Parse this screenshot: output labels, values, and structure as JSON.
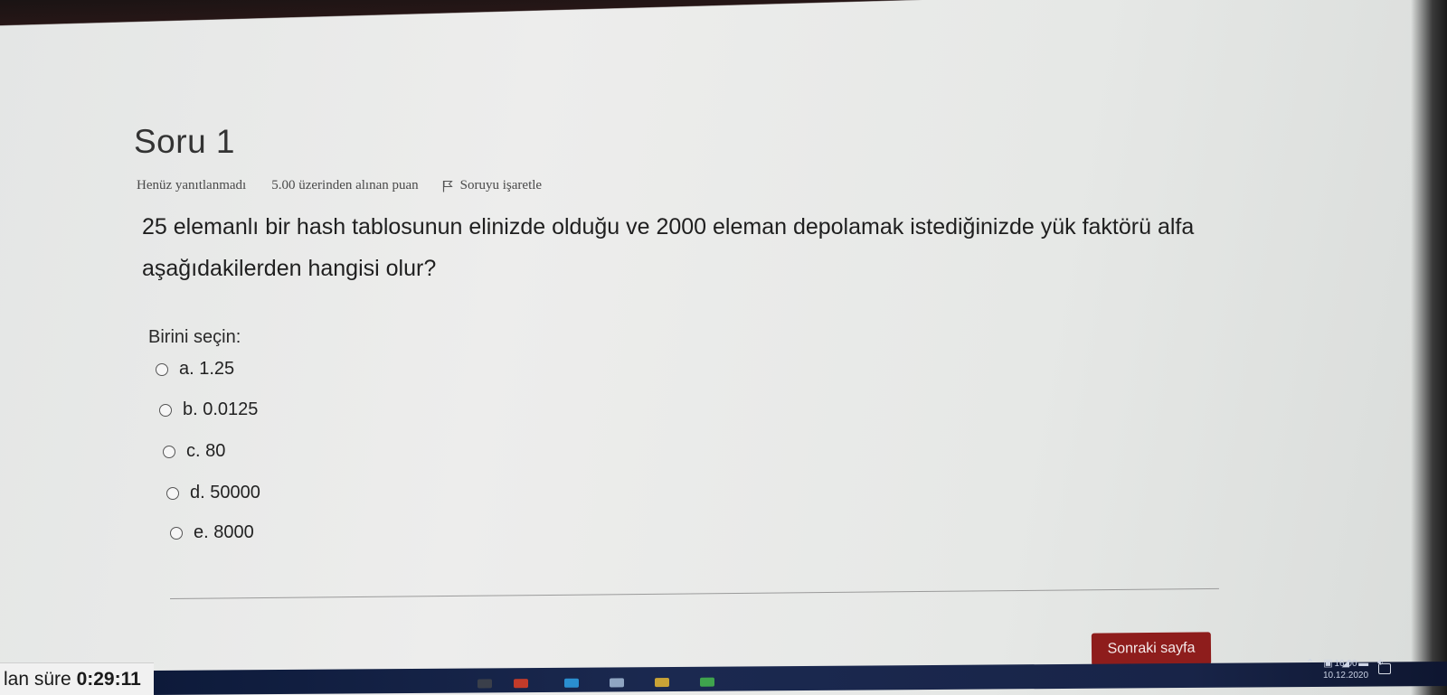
{
  "question": {
    "title": "Soru 1",
    "state": "Henüz yanıtlanmadı",
    "grade": "5.00 üzerinden alınan puan",
    "flag_label": "Soruyu işaretle",
    "text": "25 elemanlı bir hash tablosunun elinizde olduğu ve 2000 eleman depolamak istediğinizde yük faktörü alfa aşağıdakilerden hangisi olur?",
    "prompt": "Birini seçin:",
    "answers": [
      {
        "label": "a. 1.25",
        "selected": false
      },
      {
        "label": "b. 0.0125",
        "selected": false
      },
      {
        "label": "c. 80",
        "selected": false
      },
      {
        "label": "d. 50000",
        "selected": false
      },
      {
        "label": "e. 8000",
        "selected": false
      }
    ]
  },
  "navigation": {
    "next_label": "Sonraki sayfa"
  },
  "timer": {
    "label": "lan süre",
    "value": "0:29:11"
  },
  "taskbar": {
    "time": "16:00",
    "date": "10.12.2020"
  },
  "colors": {
    "next_button": "#8e1d1c",
    "taskbar": "#1b2950"
  }
}
